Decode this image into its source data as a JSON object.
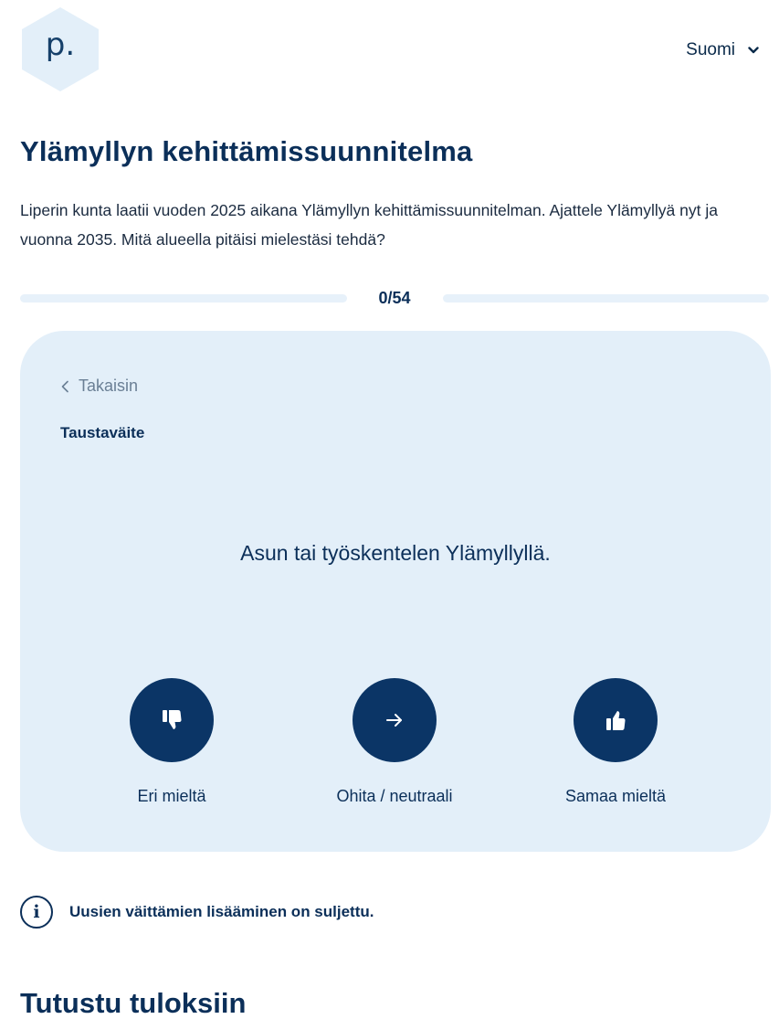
{
  "header": {
    "logo_letter": "p.",
    "language": "Suomi"
  },
  "title": "Ylämyllyn kehittämissuunnitelma",
  "intro": "Liperin kunta laatii vuoden 2025 aikana Ylämyllyn kehittämissuunnitelman. Ajattele Ylämyllyä nyt ja vuonna 2035. Mitä alueella pitäisi mielestäsi tehdä?",
  "progress": {
    "label": "0/54",
    "current": 0,
    "total": 54
  },
  "card": {
    "back_label": "Takaisin",
    "kicker": "Taustaväite",
    "statement": "Asun tai työskentelen Ylämyllyllä.",
    "votes": [
      {
        "label": "Eri mieltä",
        "icon": "thumbs-down-icon"
      },
      {
        "label": "Ohita / neutraali",
        "icon": "arrow-right-icon"
      },
      {
        "label": "Samaa mieltä",
        "icon": "thumbs-up-icon"
      }
    ]
  },
  "notice": {
    "icon_text": "i",
    "text": "Uusien väittämien lisääminen on suljettu."
  },
  "results_heading": "Tutustu tuloksiin",
  "colors": {
    "primary": "#0b3566",
    "card_bg": "#e3eff9",
    "track": "#e7f1fa",
    "logo_bg": "#e3eff9"
  }
}
